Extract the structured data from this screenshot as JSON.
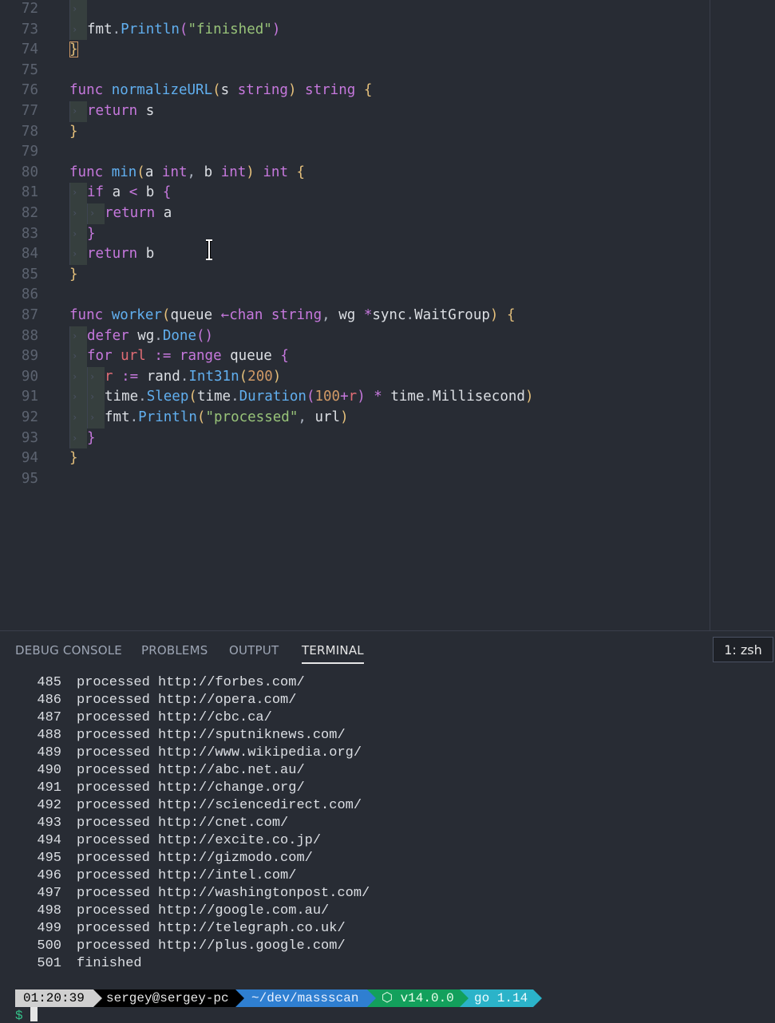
{
  "editor": {
    "lines": [
      {
        "n": "72",
        "indent": 1,
        "tokens": []
      },
      {
        "n": "73",
        "indent": 1,
        "tokens": [
          [
            "fmt",
            "id"
          ],
          [
            ".",
            "pun"
          ],
          [
            "Println",
            "mth"
          ],
          [
            "(",
            "br2"
          ],
          [
            "\"finished\"",
            "str"
          ],
          [
            ")",
            "br2"
          ]
        ]
      },
      {
        "n": "74",
        "indent": 0,
        "tokens": [
          [
            "}",
            "br1hl"
          ]
        ]
      },
      {
        "n": "75",
        "indent": 0,
        "tokens": []
      },
      {
        "n": "76",
        "indent": 0,
        "tokens": [
          [
            "func ",
            "kw"
          ],
          [
            "normalizeURL",
            "fn"
          ],
          [
            "(",
            "br1"
          ],
          [
            "s ",
            "id"
          ],
          [
            "string",
            "ty"
          ],
          [
            ") ",
            "br1"
          ],
          [
            "string",
            "ty"
          ],
          [
            " ",
            "pun"
          ],
          [
            "{",
            "br1"
          ]
        ]
      },
      {
        "n": "77",
        "indent": 1,
        "tokens": [
          [
            "return ",
            "kw"
          ],
          [
            "s",
            "id"
          ]
        ]
      },
      {
        "n": "78",
        "indent": 0,
        "tokens": [
          [
            "}",
            "br1"
          ]
        ]
      },
      {
        "n": "79",
        "indent": 0,
        "tokens": []
      },
      {
        "n": "80",
        "indent": 0,
        "tokens": [
          [
            "func ",
            "kw"
          ],
          [
            "min",
            "fn"
          ],
          [
            "(",
            "br1"
          ],
          [
            "a ",
            "id"
          ],
          [
            "int",
            "ty"
          ],
          [
            ", ",
            "pun"
          ],
          [
            "b ",
            "id"
          ],
          [
            "int",
            "ty"
          ],
          [
            ") ",
            "br1"
          ],
          [
            "int",
            "ty"
          ],
          [
            " ",
            "pun"
          ],
          [
            "{",
            "br1"
          ]
        ]
      },
      {
        "n": "81",
        "indent": 1,
        "tokens": [
          [
            "if ",
            "kw"
          ],
          [
            "a ",
            "id"
          ],
          [
            "< ",
            "op"
          ],
          [
            "b ",
            "id"
          ],
          [
            "{",
            "br2"
          ]
        ]
      },
      {
        "n": "82",
        "indent": 2,
        "tokens": [
          [
            "return ",
            "kw"
          ],
          [
            "a",
            "id"
          ]
        ]
      },
      {
        "n": "83",
        "indent": 1,
        "tokens": [
          [
            "}",
            "br2"
          ]
        ]
      },
      {
        "n": "84",
        "indent": 1,
        "tokens": [
          [
            "return ",
            "kw"
          ],
          [
            "b",
            "id"
          ]
        ]
      },
      {
        "n": "85",
        "indent": 0,
        "tokens": [
          [
            "}",
            "br1"
          ]
        ]
      },
      {
        "n": "86",
        "indent": 0,
        "tokens": []
      },
      {
        "n": "87",
        "indent": 0,
        "tokens": [
          [
            "func ",
            "kw"
          ],
          [
            "worker",
            "fn"
          ],
          [
            "(",
            "br1"
          ],
          [
            "queue ",
            "id"
          ],
          [
            "←",
            "op"
          ],
          [
            "chan ",
            "kw"
          ],
          [
            "string",
            "ty"
          ],
          [
            ", ",
            "pun"
          ],
          [
            "wg ",
            "id"
          ],
          [
            "*",
            "op"
          ],
          [
            "sync",
            "id"
          ],
          [
            ".",
            "pun"
          ],
          [
            "WaitGroup",
            "id"
          ],
          [
            ") ",
            "br1"
          ],
          [
            "{",
            "br1"
          ]
        ]
      },
      {
        "n": "88",
        "indent": 1,
        "tokens": [
          [
            "defer ",
            "kw"
          ],
          [
            "wg",
            "id"
          ],
          [
            ".",
            "pun"
          ],
          [
            "Done",
            "mth"
          ],
          [
            "()",
            "br2"
          ]
        ]
      },
      {
        "n": "89",
        "indent": 1,
        "tokens": [
          [
            "for ",
            "kw"
          ],
          [
            "url ",
            "var"
          ],
          [
            ":= ",
            "op"
          ],
          [
            "range ",
            "kw"
          ],
          [
            "queue ",
            "id"
          ],
          [
            "{",
            "br2"
          ]
        ]
      },
      {
        "n": "90",
        "indent": 2,
        "tokens": [
          [
            "r ",
            "var"
          ],
          [
            ":= ",
            "op"
          ],
          [
            "rand",
            "id"
          ],
          [
            ".",
            "pun"
          ],
          [
            "Int31n",
            "mth"
          ],
          [
            "(",
            "br3"
          ],
          [
            "200",
            "num"
          ],
          [
            ")",
            "br3"
          ]
        ]
      },
      {
        "n": "91",
        "indent": 2,
        "tokens": [
          [
            "time",
            "id"
          ],
          [
            ".",
            "pun"
          ],
          [
            "Sleep",
            "mth"
          ],
          [
            "(",
            "br3"
          ],
          [
            "time",
            "id"
          ],
          [
            ".",
            "pun"
          ],
          [
            "Duration",
            "mth"
          ],
          [
            "(",
            "br2"
          ],
          [
            "100",
            "num"
          ],
          [
            "+",
            "op"
          ],
          [
            "r",
            "var"
          ],
          [
            ") ",
            "br2"
          ],
          [
            "* ",
            "op"
          ],
          [
            "time",
            "id"
          ],
          [
            ".",
            "pun"
          ],
          [
            "Millisecond",
            "id"
          ],
          [
            ")",
            "br3"
          ]
        ]
      },
      {
        "n": "92",
        "indent": 2,
        "tokens": [
          [
            "fmt",
            "id"
          ],
          [
            ".",
            "pun"
          ],
          [
            "Println",
            "mth"
          ],
          [
            "(",
            "br3"
          ],
          [
            "\"processed\"",
            "str"
          ],
          [
            ", ",
            "pun"
          ],
          [
            "url",
            "id"
          ],
          [
            ")",
            "br3"
          ]
        ]
      },
      {
        "n": "93",
        "indent": 1,
        "tokens": [
          [
            "}",
            "br2"
          ]
        ]
      },
      {
        "n": "94",
        "indent": 0,
        "tokens": [
          [
            "}",
            "br1"
          ]
        ]
      },
      {
        "n": "95",
        "indent": 0,
        "tokens": []
      }
    ]
  },
  "panel": {
    "tabs": [
      {
        "label": "DEBUG CONSOLE",
        "name": "tab-debug-console"
      },
      {
        "label": "PROBLEMS",
        "name": "tab-problems"
      },
      {
        "label": "OUTPUT",
        "name": "tab-output"
      },
      {
        "label": "TERMINAL",
        "name": "tab-terminal",
        "active": true
      }
    ],
    "terminal_select": "1: zsh"
  },
  "terminal": {
    "lines": [
      {
        "n": "485",
        "text": "processed http://forbes.com/"
      },
      {
        "n": "486",
        "text": "processed http://opera.com/"
      },
      {
        "n": "487",
        "text": "processed http://cbc.ca/"
      },
      {
        "n": "488",
        "text": "processed http://sputniknews.com/"
      },
      {
        "n": "489",
        "text": "processed http://www.wikipedia.org/"
      },
      {
        "n": "490",
        "text": "processed http://abc.net.au/"
      },
      {
        "n": "491",
        "text": "processed http://change.org/"
      },
      {
        "n": "492",
        "text": "processed http://sciencedirect.com/"
      },
      {
        "n": "493",
        "text": "processed http://cnet.com/"
      },
      {
        "n": "494",
        "text": "processed http://excite.co.jp/"
      },
      {
        "n": "495",
        "text": "processed http://gizmodo.com/"
      },
      {
        "n": "496",
        "text": "processed http://intel.com/"
      },
      {
        "n": "497",
        "text": "processed http://washingtonpost.com/"
      },
      {
        "n": "498",
        "text": "processed http://google.com.au/"
      },
      {
        "n": "499",
        "text": "processed http://telegraph.co.uk/"
      },
      {
        "n": "500",
        "text": "processed http://plus.google.com/"
      },
      {
        "n": "501",
        "text": "finished"
      }
    ],
    "prompt": {
      "time": "01:20:39",
      "user": "sergey@sergey-pc",
      "path": "~/dev/massscan",
      "node": "⬡ v14.0.0",
      "go": "go 1.14",
      "symbol": "$"
    }
  },
  "icons": {
    "text_cursor": "i-beam-cursor-icon"
  }
}
